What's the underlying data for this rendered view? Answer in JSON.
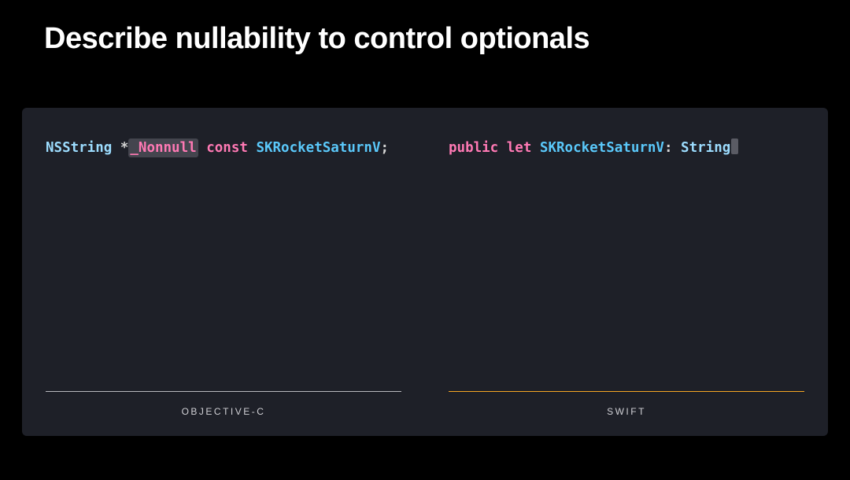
{
  "title": "Describe nullability to control optionals",
  "left": {
    "label": "OBJECTIVE-C",
    "code": {
      "t0": "NSString",
      "t1": " *",
      "t2": "_Nonnull",
      "t3": " ",
      "t4": "const",
      "t5": " ",
      "t6": "SKRocketSaturnV",
      "t7": ";"
    }
  },
  "right": {
    "label": "SWIFT",
    "code": {
      "t0": "public",
      "t1": " ",
      "t2": "let",
      "t3": " ",
      "t4": "SKRocketSaturnV",
      "t5": ": ",
      "t6": "String"
    }
  }
}
